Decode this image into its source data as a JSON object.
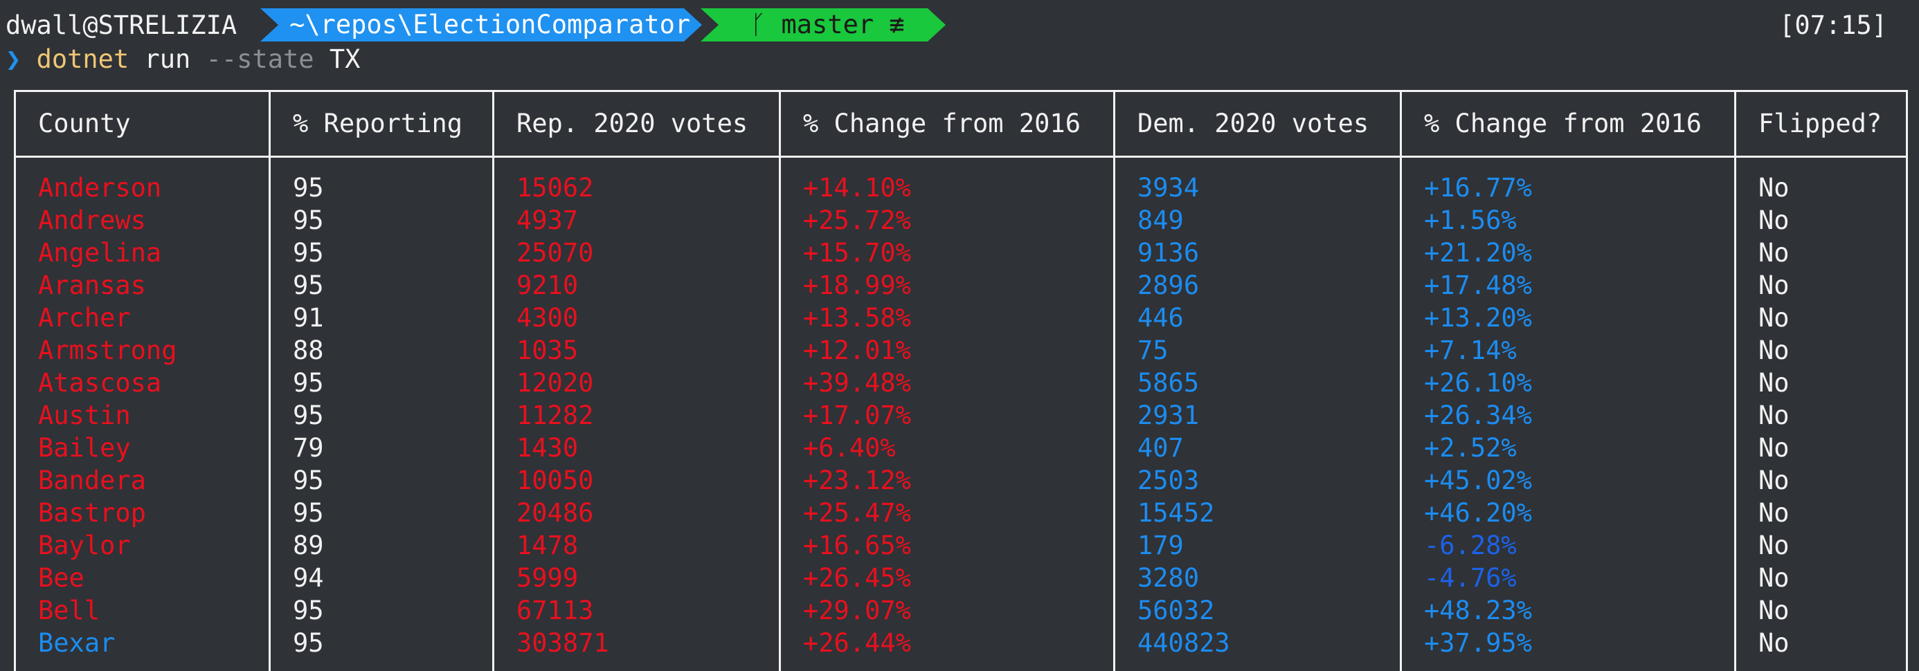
{
  "prompt": {
    "user_host": "dwall@STRELIZIA",
    "path": "~\\repos\\ElectionComparator",
    "git_branch_icon": "git-branch-icon",
    "git_branch_glyph": "ᚴ",
    "git_branch": "master",
    "git_status": "≢",
    "time": "[07:15]"
  },
  "command": {
    "chevron": "❯",
    "program": "dotnet",
    "subcommand": "run",
    "flag": "--state",
    "argument": "TX"
  },
  "colors": {
    "republican": "#e8101e",
    "democrat": "#1c8cf0",
    "negative_change": "#1c62e8",
    "path_segment": "#1f91f0",
    "git_segment": "#19c83c",
    "background": "#2f3237"
  },
  "table": {
    "headers": [
      "County",
      "% Reporting",
      "Rep. 2020 votes",
      "% Change from 2016",
      "Dem. 2020 votes",
      "% Change from 2016",
      "Flipped?"
    ],
    "rows": [
      {
        "county": "Anderson",
        "reporting": "95",
        "rep_votes": "15062",
        "rep_change": "+14.10%",
        "dem_votes": "3934",
        "dem_change": "+16.77%",
        "flipped": "No",
        "winner": "rep"
      },
      {
        "county": "Andrews",
        "reporting": "95",
        "rep_votes": "4937",
        "rep_change": "+25.72%",
        "dem_votes": "849",
        "dem_change": "+1.56%",
        "flipped": "No",
        "winner": "rep"
      },
      {
        "county": "Angelina",
        "reporting": "95",
        "rep_votes": "25070",
        "rep_change": "+15.70%",
        "dem_votes": "9136",
        "dem_change": "+21.20%",
        "flipped": "No",
        "winner": "rep"
      },
      {
        "county": "Aransas",
        "reporting": "95",
        "rep_votes": "9210",
        "rep_change": "+18.99%",
        "dem_votes": "2896",
        "dem_change": "+17.48%",
        "flipped": "No",
        "winner": "rep"
      },
      {
        "county": "Archer",
        "reporting": "91",
        "rep_votes": "4300",
        "rep_change": "+13.58%",
        "dem_votes": "446",
        "dem_change": "+13.20%",
        "flipped": "No",
        "winner": "rep"
      },
      {
        "county": "Armstrong",
        "reporting": "88",
        "rep_votes": "1035",
        "rep_change": "+12.01%",
        "dem_votes": "75",
        "dem_change": "+7.14%",
        "flipped": "No",
        "winner": "rep"
      },
      {
        "county": "Atascosa",
        "reporting": "95",
        "rep_votes": "12020",
        "rep_change": "+39.48%",
        "dem_votes": "5865",
        "dem_change": "+26.10%",
        "flipped": "No",
        "winner": "rep"
      },
      {
        "county": "Austin",
        "reporting": "95",
        "rep_votes": "11282",
        "rep_change": "+17.07%",
        "dem_votes": "2931",
        "dem_change": "+26.34%",
        "flipped": "No",
        "winner": "rep"
      },
      {
        "county": "Bailey",
        "reporting": "79",
        "rep_votes": "1430",
        "rep_change": "+6.40%",
        "dem_votes": "407",
        "dem_change": "+2.52%",
        "flipped": "No",
        "winner": "rep"
      },
      {
        "county": "Bandera",
        "reporting": "95",
        "rep_votes": "10050",
        "rep_change": "+23.12%",
        "dem_votes": "2503",
        "dem_change": "+45.02%",
        "flipped": "No",
        "winner": "rep"
      },
      {
        "county": "Bastrop",
        "reporting": "95",
        "rep_votes": "20486",
        "rep_change": "+25.47%",
        "dem_votes": "15452",
        "dem_change": "+46.20%",
        "flipped": "No",
        "winner": "rep"
      },
      {
        "county": "Baylor",
        "reporting": "89",
        "rep_votes": "1478",
        "rep_change": "+16.65%",
        "dem_votes": "179",
        "dem_change": "-6.28%",
        "flipped": "No",
        "winner": "rep"
      },
      {
        "county": "Bee",
        "reporting": "94",
        "rep_votes": "5999",
        "rep_change": "+26.45%",
        "dem_votes": "3280",
        "dem_change": "-4.76%",
        "flipped": "No",
        "winner": "rep"
      },
      {
        "county": "Bell",
        "reporting": "95",
        "rep_votes": "67113",
        "rep_change": "+29.07%",
        "dem_votes": "56032",
        "dem_change": "+48.23%",
        "flipped": "No",
        "winner": "rep"
      },
      {
        "county": "Bexar",
        "reporting": "95",
        "rep_votes": "303871",
        "rep_change": "+26.44%",
        "dem_votes": "440823",
        "dem_change": "+37.95%",
        "flipped": "No",
        "winner": "dem"
      }
    ]
  }
}
